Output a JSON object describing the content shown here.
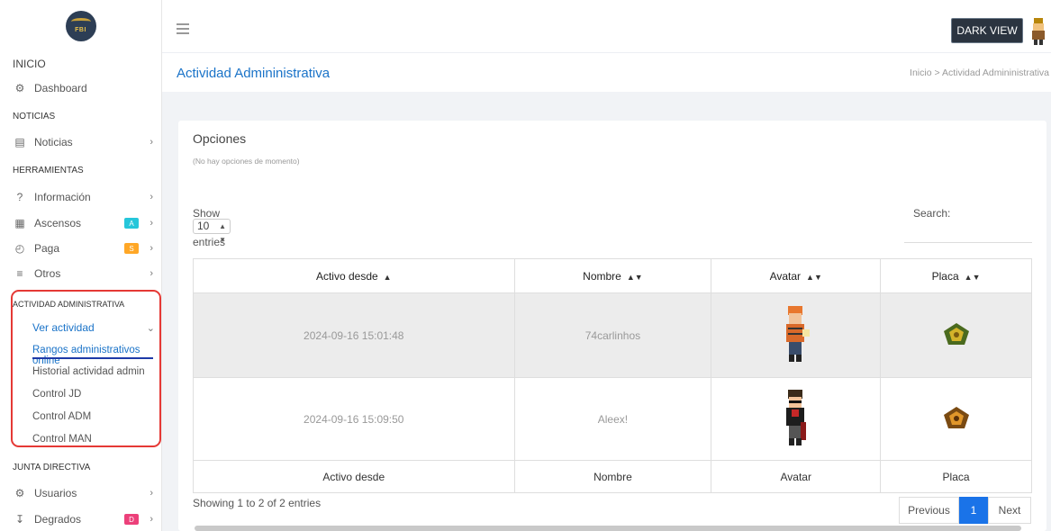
{
  "sidebar": {
    "logo_text": "FBI",
    "sections": {
      "inicio": "INICIO",
      "noticias": "NOTICIAS",
      "herramientas": "HERRAMIENTAS",
      "actividad": "ACTIVIDAD ADMINISTRATIVA",
      "junta": "JUNTA DIRECTIVA"
    },
    "items": {
      "dashboard": "Dashboard",
      "noticias": "Noticias",
      "informacion": "Información",
      "ascensos": "Ascensos",
      "paga": "Paga",
      "otros": "Otros",
      "ver_actividad": "Ver actividad",
      "usuarios": "Usuarios",
      "degrados": "Degrados"
    },
    "badges": {
      "ascensos": "A",
      "paga": "S",
      "degrados": "D"
    },
    "sub_items": {
      "rangos": "Rangos administrativos online",
      "historial": "Historial actividad admin",
      "control_jd": "Control JD",
      "control_adm": "Control ADM",
      "control_man": "Control MAN"
    }
  },
  "topbar": {
    "dark_view_label": "DARK VIEW"
  },
  "page": {
    "title": "Actividad Admininistrativa",
    "breadcrumb": "Inicio  >  Actividad Admininistrativa"
  },
  "options": {
    "title": "Opciones",
    "subtitle": "(No hay opciones de momento)"
  },
  "table_controls": {
    "show_label": "Show",
    "show_value": "10",
    "entries_label": "entries",
    "search_label": "Search:"
  },
  "table": {
    "columns": [
      "Activo desde",
      "Nombre",
      "Avatar",
      "Placa"
    ],
    "rows": [
      {
        "activo": "2024-09-16 15:01:48",
        "nombre": "74carlinhos"
      },
      {
        "activo": "2024-09-16 15:09:50",
        "nombre": "Aleex!"
      }
    ]
  },
  "footer": {
    "info": "Showing 1 to 2 of 2 entries",
    "previous": "Previous",
    "current_page": "1",
    "next": "Next"
  },
  "colors": {
    "accent_blue": "#1a73e8",
    "title_blue": "#1a73c8",
    "highlight_red": "#e53935",
    "badge_cyan": "#26c6da",
    "badge_orange": "#ffa726",
    "badge_pink": "#ec407a"
  }
}
